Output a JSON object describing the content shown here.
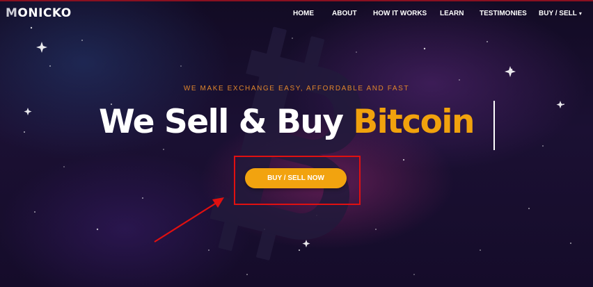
{
  "navbar": {
    "logo": {
      "first_letter": "M",
      "rest": "ONICKO"
    },
    "links": [
      "HOME",
      "ABOUT",
      "HOW IT WORKS",
      "LEARN",
      "TESTIMONIES"
    ],
    "dropdown": {
      "label": "BUY / SELL",
      "caret": "▾"
    }
  },
  "hero": {
    "tagline": "WE MAKE EXCHANGE EASY, AFFORDABLE AND FAST",
    "headline": {
      "main": "We Sell & Buy ",
      "accent": "Bitcoin"
    },
    "cta_label": "BUY / SELL NOW",
    "background_icon": "bitcoin-icon"
  },
  "colors": {
    "accent": "#f1a20d",
    "tagline": "#e0862b",
    "annotation": "#e11010",
    "background": "#1b1033"
  }
}
